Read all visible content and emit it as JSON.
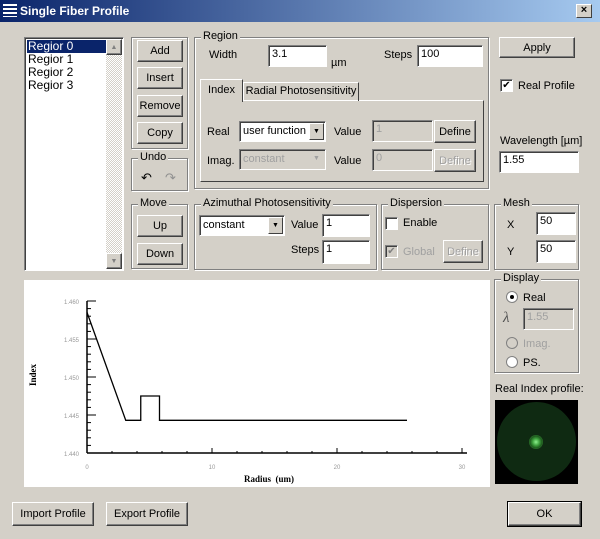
{
  "window": {
    "title": "Single Fiber Profile",
    "close_label": "×"
  },
  "regions": {
    "items": [
      "Regior 0",
      "Regior 1",
      "Regior 2",
      "Regior 3"
    ],
    "selected": 0
  },
  "buttons": {
    "add": "Add",
    "insert": "Insert",
    "remove": "Remove",
    "copy": "Copy",
    "up": "Up",
    "down": "Down",
    "apply": "Apply",
    "import": "Import Profile",
    "export": "Export Profile",
    "ok": "OK"
  },
  "undo": {
    "label": "Undo",
    "undo_icon": "undo-arrow",
    "redo_icon": "redo-arrow"
  },
  "move": {
    "label": "Move"
  },
  "region": {
    "label": "Region",
    "width_label": "Width",
    "width_value": "3.1",
    "unit": "µm",
    "steps_label": "Steps",
    "steps_value": "100",
    "tabs": [
      "Index",
      "Radial Photosensitivity"
    ],
    "active_tab": 0,
    "real_label": "Real",
    "real_select": "user function",
    "real_value_label": "Value",
    "real_value": "1",
    "real_define": "Define",
    "imag_label": "Imag.",
    "imag_select": "constant",
    "imag_value_label": "Value",
    "imag_value": "0",
    "imag_define": "Define"
  },
  "azimuthal": {
    "label": "Azimuthal Photosensitivity",
    "select": "constant",
    "value_label": "Value",
    "value": "1",
    "steps_label": "Steps",
    "steps": "1"
  },
  "dispersion": {
    "label": "Dispersion",
    "enable_label": "Enable",
    "enable_checked": false,
    "global_label": "Global",
    "global_checked": true,
    "define": "Define"
  },
  "right": {
    "real_profile_label": "Real Profile",
    "real_profile_checked": true,
    "wavelength_label": "Wavelength [µm]",
    "wavelength_value": "1.55"
  },
  "mesh": {
    "label": "Mesh",
    "x_label": "X",
    "x_value": "50",
    "y_label": "Y",
    "y_value": "50"
  },
  "display": {
    "label": "Display",
    "real": "Real",
    "lambda_symbol": "λ",
    "lambda_value": "1.55",
    "imag": "Imag.",
    "ps": "PS.",
    "selected": "Real",
    "preview_label": "Real Index profile:"
  },
  "chart_data": {
    "type": "line",
    "xlabel": "Radius  (um)",
    "ylabel": "Index",
    "xlim": [
      0,
      30
    ],
    "ylim": [
      1.44,
      1.46
    ],
    "xticks": [
      "0",
      "10",
      "20",
      "30"
    ],
    "yticks": [
      "1.440",
      "1.445",
      "1.450",
      "1.455",
      "1.460"
    ],
    "x": [
      0,
      3.1,
      4.3,
      4.3,
      5.8,
      5.8,
      25.6
    ],
    "y": [
      1.4585,
      1.4443,
      1.4443,
      1.4475,
      1.4475,
      1.4443,
      1.4443
    ],
    "grid": false
  }
}
